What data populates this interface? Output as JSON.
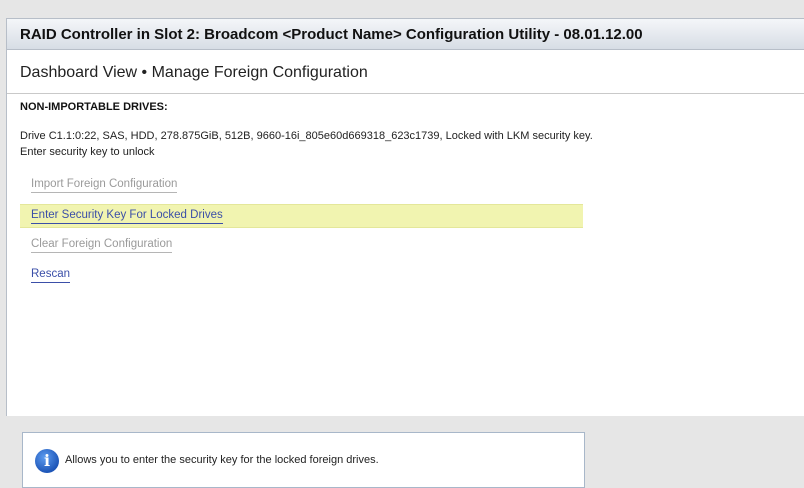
{
  "window": {
    "title": "RAID Controller in Slot 2: Broadcom <Product Name> Configuration Utility - 08.01.12.00"
  },
  "page": {
    "heading": "Dashboard View • Manage Foreign Configuration",
    "section_label": "NON-IMPORTABLE DRIVES:",
    "drive_info": "Drive C1.1:0:22, SAS, HDD, 278.875GiB, 512B, 9660-16i_805e60d669318_623c1739, Locked with LKM security key. Enter security key to unlock"
  },
  "actions": [
    {
      "label": "Import Foreign Configuration",
      "state": "disabled"
    },
    {
      "label": "Enter Security Key For Locked Drives",
      "state": "selected"
    },
    {
      "label": "Clear Foreign Configuration",
      "state": "disabled"
    },
    {
      "label": "Rescan",
      "state": "enabled"
    }
  ],
  "help": {
    "icon": "info-icon",
    "text": "Allows you to enter the security key for the locked foreign drives."
  },
  "colors": {
    "highlight": "#f1f4b0",
    "link": "#3b4fa8",
    "disabled": "#9a9a9a",
    "info_icon": "#1e56b8"
  }
}
